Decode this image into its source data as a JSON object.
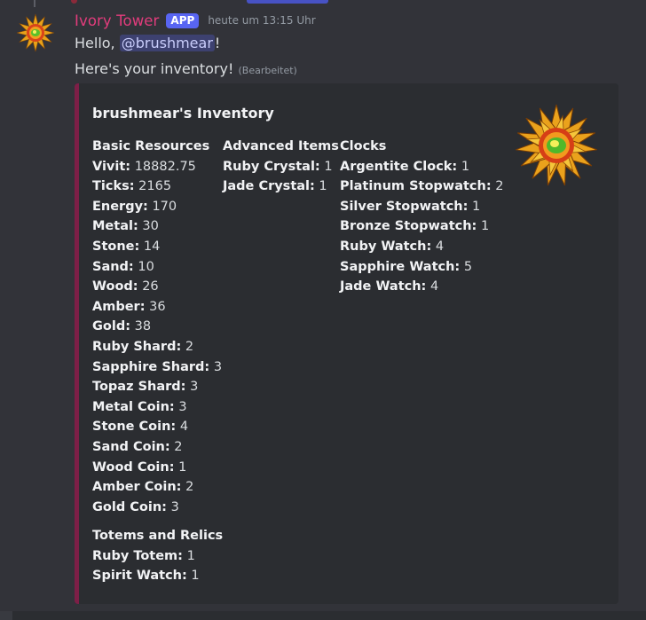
{
  "message": {
    "author": "Ivory Tower",
    "badge": "APP",
    "timestamp": "heute um 13:15 Uhr",
    "hello_prefix": "Hello, ",
    "mention": "@brushmear",
    "hello_suffix": "!",
    "line2": "Here's your inventory!",
    "edited": "(Bearbeitet)"
  },
  "colors": {
    "author": "#e23c7c",
    "badge": "#5865f2",
    "embed_border": "#7d1f47",
    "embed_bg": "#2b2d31",
    "background": "#323339"
  },
  "icons": {
    "avatar": "sun-avatar-icon",
    "thumbnail": "sun-thumbnail-icon"
  },
  "embed": {
    "title": "brushmear's Inventory",
    "basic": {
      "title": "Basic Resources",
      "items": [
        {
          "k": "Vivit:",
          "v": "18882.75"
        },
        {
          "k": "Ticks:",
          "v": "2165"
        },
        {
          "k": "Energy:",
          "v": "170"
        },
        {
          "k": "Metal:",
          "v": "30"
        },
        {
          "k": "Stone:",
          "v": "14"
        },
        {
          "k": "Sand:",
          "v": "10"
        },
        {
          "k": "Wood:",
          "v": "26"
        },
        {
          "k": "Amber:",
          "v": "36"
        },
        {
          "k": "Gold:",
          "v": "38"
        },
        {
          "k": "Ruby Shard:",
          "v": "2"
        },
        {
          "k": "Sapphire Shard:",
          "v": "3"
        },
        {
          "k": "Topaz Shard:",
          "v": "3"
        },
        {
          "k": "Metal Coin:",
          "v": "3"
        },
        {
          "k": "Stone Coin:",
          "v": "4"
        },
        {
          "k": "Sand Coin:",
          "v": "2"
        },
        {
          "k": "Wood Coin:",
          "v": "1"
        },
        {
          "k": "Amber Coin:",
          "v": "2"
        },
        {
          "k": "Gold Coin:",
          "v": "3"
        }
      ]
    },
    "advanced": {
      "title": "Advanced Items",
      "items": [
        {
          "k": "Ruby Crystal:",
          "v": "1"
        },
        {
          "k": "Jade Crystal:",
          "v": "1"
        }
      ]
    },
    "clocks": {
      "title": "Clocks",
      "items": [
        {
          "k": "Argentite Clock:",
          "v": "1"
        },
        {
          "k": "Platinum Stopwatch:",
          "v": "2"
        },
        {
          "k": "Silver Stopwatch:",
          "v": "1"
        },
        {
          "k": "Bronze Stopwatch:",
          "v": "1"
        },
        {
          "k": "Ruby Watch:",
          "v": "4"
        },
        {
          "k": "Sapphire Watch:",
          "v": "5"
        },
        {
          "k": "Jade Watch:",
          "v": "4"
        }
      ]
    },
    "totems": {
      "title": "Totems and Relics",
      "items": [
        {
          "k": "Ruby Totem:",
          "v": "1"
        },
        {
          "k": "Spirit Watch:",
          "v": "1"
        }
      ]
    }
  }
}
